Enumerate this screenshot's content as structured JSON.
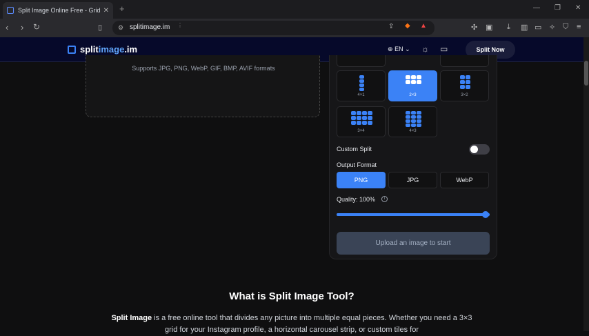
{
  "browser": {
    "tab_title": "Split Image Online Free - Grid M",
    "url": "splitimage.im"
  },
  "site": {
    "logo_main": "split",
    "logo_accent": "image",
    "logo_tld": ".im",
    "lang": "EN",
    "split_now": "Split Now"
  },
  "upload": {
    "formats": "Supports JPG, PNG, WebP, GIF, BMP, AVIF formats"
  },
  "panel": {
    "grids": [
      {
        "label": "4×1",
        "rows": 4,
        "cols": 1,
        "active": false
      },
      {
        "label": "2×3",
        "rows": 2,
        "cols": 3,
        "active": true
      },
      {
        "label": "3×2",
        "rows": 3,
        "cols": 2,
        "active": false
      },
      {
        "label": "3×4",
        "rows": 3,
        "cols": 4,
        "active": false
      },
      {
        "label": "4×3",
        "rows": 4,
        "cols": 3,
        "active": false
      }
    ],
    "custom_split": "Custom Split",
    "custom_split_on": false,
    "output_format": "Output Format",
    "formats": [
      "PNG",
      "JPG",
      "WebP"
    ],
    "selected_format": "PNG",
    "quality_label": "Quality: 100%",
    "quality_value": 1.0,
    "start_button": "Upload an image to start"
  },
  "content": {
    "title": "What is Split Image Tool?",
    "desc_bold": "Split Image",
    "desc_rest": " is a free online tool that divides any picture into multiple equal pieces. Whether you need a 3×3 grid for your Instagram profile, a horizontal carousel strip, or custom tiles for"
  },
  "colors": {
    "accent": "#3b82f6",
    "header_bg": "#06092a",
    "page_bg": "#0f0f10"
  }
}
